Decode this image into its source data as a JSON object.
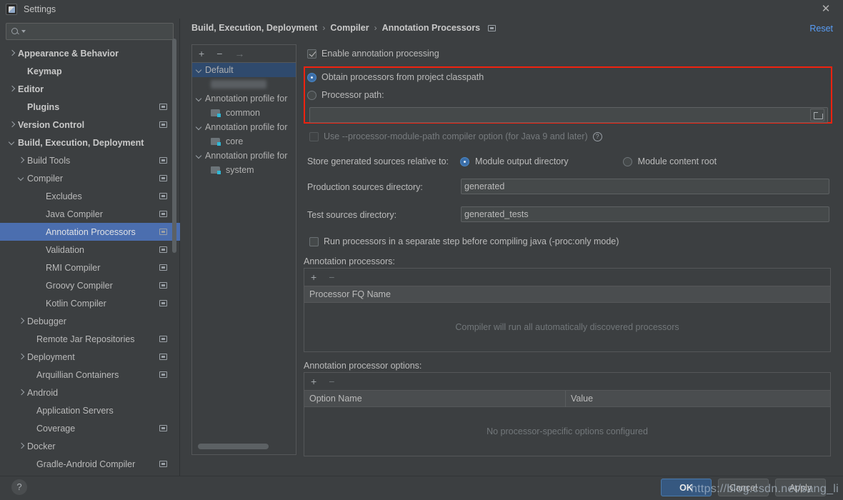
{
  "window": {
    "title": "Settings",
    "app_icon": "intellij-idea-icon",
    "close_icon": "close-icon"
  },
  "sidebar": {
    "search": {
      "placeholder": "",
      "value": "",
      "icon": "search-icon"
    },
    "items": [
      {
        "label": "Appearance & Behavior",
        "arrow": "right",
        "indent": 0,
        "bold": true,
        "badge": false,
        "selected": false
      },
      {
        "label": "Keymap",
        "arrow": "none",
        "indent": 1,
        "bold": true,
        "badge": false,
        "selected": false
      },
      {
        "label": "Editor",
        "arrow": "right",
        "indent": 0,
        "bold": true,
        "badge": false,
        "selected": false
      },
      {
        "label": "Plugins",
        "arrow": "none",
        "indent": 1,
        "bold": true,
        "badge": true,
        "selected": false
      },
      {
        "label": "Version Control",
        "arrow": "right",
        "indent": 0,
        "bold": true,
        "badge": true,
        "selected": false
      },
      {
        "label": "Build, Execution, Deployment",
        "arrow": "down",
        "indent": 0,
        "bold": true,
        "badge": false,
        "selected": false
      },
      {
        "label": "Build Tools",
        "arrow": "right",
        "indent": 1,
        "bold": false,
        "badge": true,
        "selected": false
      },
      {
        "label": "Compiler",
        "arrow": "down",
        "indent": 1,
        "bold": false,
        "badge": true,
        "selected": false
      },
      {
        "label": "Excludes",
        "arrow": "none",
        "indent": 3,
        "bold": false,
        "badge": true,
        "selected": false
      },
      {
        "label": "Java Compiler",
        "arrow": "none",
        "indent": 3,
        "bold": false,
        "badge": true,
        "selected": false
      },
      {
        "label": "Annotation Processors",
        "arrow": "none",
        "indent": 3,
        "bold": false,
        "badge": true,
        "selected": true
      },
      {
        "label": "Validation",
        "arrow": "none",
        "indent": 3,
        "bold": false,
        "badge": true,
        "selected": false
      },
      {
        "label": "RMI Compiler",
        "arrow": "none",
        "indent": 3,
        "bold": false,
        "badge": true,
        "selected": false
      },
      {
        "label": "Groovy Compiler",
        "arrow": "none",
        "indent": 3,
        "bold": false,
        "badge": true,
        "selected": false
      },
      {
        "label": "Kotlin Compiler",
        "arrow": "none",
        "indent": 3,
        "bold": false,
        "badge": true,
        "selected": false
      },
      {
        "label": "Debugger",
        "arrow": "right",
        "indent": 1,
        "bold": false,
        "badge": false,
        "selected": false
      },
      {
        "label": "Remote Jar Repositories",
        "arrow": "none",
        "indent": 2,
        "bold": false,
        "badge": true,
        "selected": false
      },
      {
        "label": "Deployment",
        "arrow": "right",
        "indent": 1,
        "bold": false,
        "badge": true,
        "selected": false
      },
      {
        "label": "Arquillian Containers",
        "arrow": "none",
        "indent": 2,
        "bold": false,
        "badge": true,
        "selected": false
      },
      {
        "label": "Android",
        "arrow": "right",
        "indent": 1,
        "bold": false,
        "badge": false,
        "selected": false
      },
      {
        "label": "Application Servers",
        "arrow": "none",
        "indent": 2,
        "bold": false,
        "badge": false,
        "selected": false
      },
      {
        "label": "Coverage",
        "arrow": "none",
        "indent": 2,
        "bold": false,
        "badge": true,
        "selected": false
      },
      {
        "label": "Docker",
        "arrow": "right",
        "indent": 1,
        "bold": false,
        "badge": false,
        "selected": false
      },
      {
        "label": "Gradle-Android Compiler",
        "arrow": "none",
        "indent": 2,
        "bold": false,
        "badge": true,
        "selected": false
      }
    ]
  },
  "header": {
    "breadcrumb": [
      "Build, Execution, Deployment",
      "Compiler",
      "Annotation Processors"
    ],
    "separator": "›",
    "project_badge_icon": "project-scope-icon",
    "reset_label": "Reset"
  },
  "profiles": {
    "toolbar": {
      "add": "+",
      "remove": "−",
      "move": "→"
    },
    "rows": [
      {
        "type": "node",
        "label": "Default",
        "selected": true
      },
      {
        "type": "blurred",
        "label": ""
      },
      {
        "type": "node",
        "label": "Annotation profile for",
        "selected": false
      },
      {
        "type": "module",
        "label": "common"
      },
      {
        "type": "node",
        "label": "Annotation profile for",
        "selected": false
      },
      {
        "type": "module",
        "label": "core"
      },
      {
        "type": "node",
        "label": "Annotation profile for",
        "selected": false
      },
      {
        "type": "module",
        "label": "system"
      }
    ]
  },
  "main": {
    "enable_annotation_processing": {
      "label": "Enable annotation processing",
      "checked": true
    },
    "source_group": {
      "obtain_from_classpath": {
        "label": "Obtain processors from project classpath",
        "selected": true
      },
      "processor_path": {
        "label": "Processor path:",
        "selected": false,
        "value": "",
        "browse_icon": "folder-icon"
      }
    },
    "module_path_option": {
      "label": "Use --processor-module-path compiler option (for Java 9 and later)",
      "checked": false,
      "help_icon": "help-icon"
    },
    "store_relative": {
      "label": "Store generated sources relative to:",
      "options": [
        {
          "label": "Module output directory",
          "selected": true
        },
        {
          "label": "Module content root",
          "selected": false
        }
      ]
    },
    "production_sources": {
      "label": "Production sources directory:",
      "value": "generated"
    },
    "test_sources": {
      "label": "Test sources directory:",
      "value": "generated_tests"
    },
    "separate_step": {
      "label": "Run processors in a separate step before compiling java (-proc:only mode)",
      "checked": false
    },
    "processors_table": {
      "label": "Annotation processors:",
      "toolbar": {
        "add": "+",
        "remove": "−"
      },
      "columns": [
        "Processor FQ Name"
      ],
      "rows": [],
      "empty_text": "Compiler will run all automatically discovered processors"
    },
    "options_table": {
      "label": "Annotation processor options:",
      "toolbar": {
        "add": "+",
        "remove": "−"
      },
      "columns": [
        "Option Name",
        "Value"
      ],
      "rows": [],
      "empty_text": "No processor-specific options configured"
    }
  },
  "footer": {
    "help_icon": "?",
    "ok_label": "OK",
    "cancel_label": "Cancel",
    "apply_label": "Apply"
  },
  "watermark": {
    "text": "https://blog.csdn.net/sang_li"
  },
  "colors": {
    "background": "#3c3f41",
    "selection_blue": "#4b6eaf",
    "link_blue": "#589df6",
    "primary_button": "#365880",
    "highlight_red": "#f0220f",
    "module_badge": "#2fb8d6"
  }
}
